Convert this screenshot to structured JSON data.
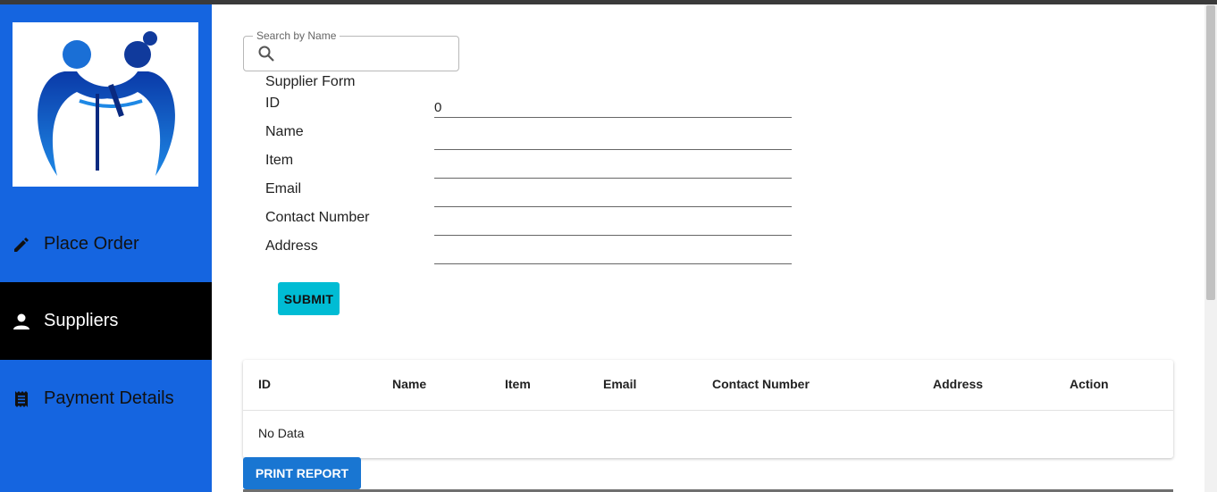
{
  "sidebar": {
    "items": [
      {
        "label": "Place Order",
        "icon": "pencil-icon"
      },
      {
        "label": "Suppliers",
        "icon": "person-icon"
      },
      {
        "label": "Payment Details",
        "icon": "receipt-icon"
      }
    ],
    "active": "Suppliers"
  },
  "search": {
    "label": "Search by Name",
    "value": ""
  },
  "form": {
    "title": "Supplier Form",
    "fields": [
      {
        "label": "ID",
        "value": "0"
      },
      {
        "label": "Name",
        "value": ""
      },
      {
        "label": "Item",
        "value": ""
      },
      {
        "label": "Email",
        "value": ""
      },
      {
        "label": "Contact Number",
        "value": ""
      },
      {
        "label": "Address",
        "value": ""
      }
    ],
    "submit_label": "SUBMIT"
  },
  "table": {
    "columns": [
      "ID",
      "Name",
      "Item",
      "Email",
      "Contact Number",
      "Address",
      "Action"
    ],
    "empty_text": "No Data"
  },
  "print_label": "PRINT REPORT",
  "colors": {
    "sidebar": "#1565e0",
    "active": "#000000",
    "submit": "#00bcd4",
    "print": "#1976d2"
  }
}
